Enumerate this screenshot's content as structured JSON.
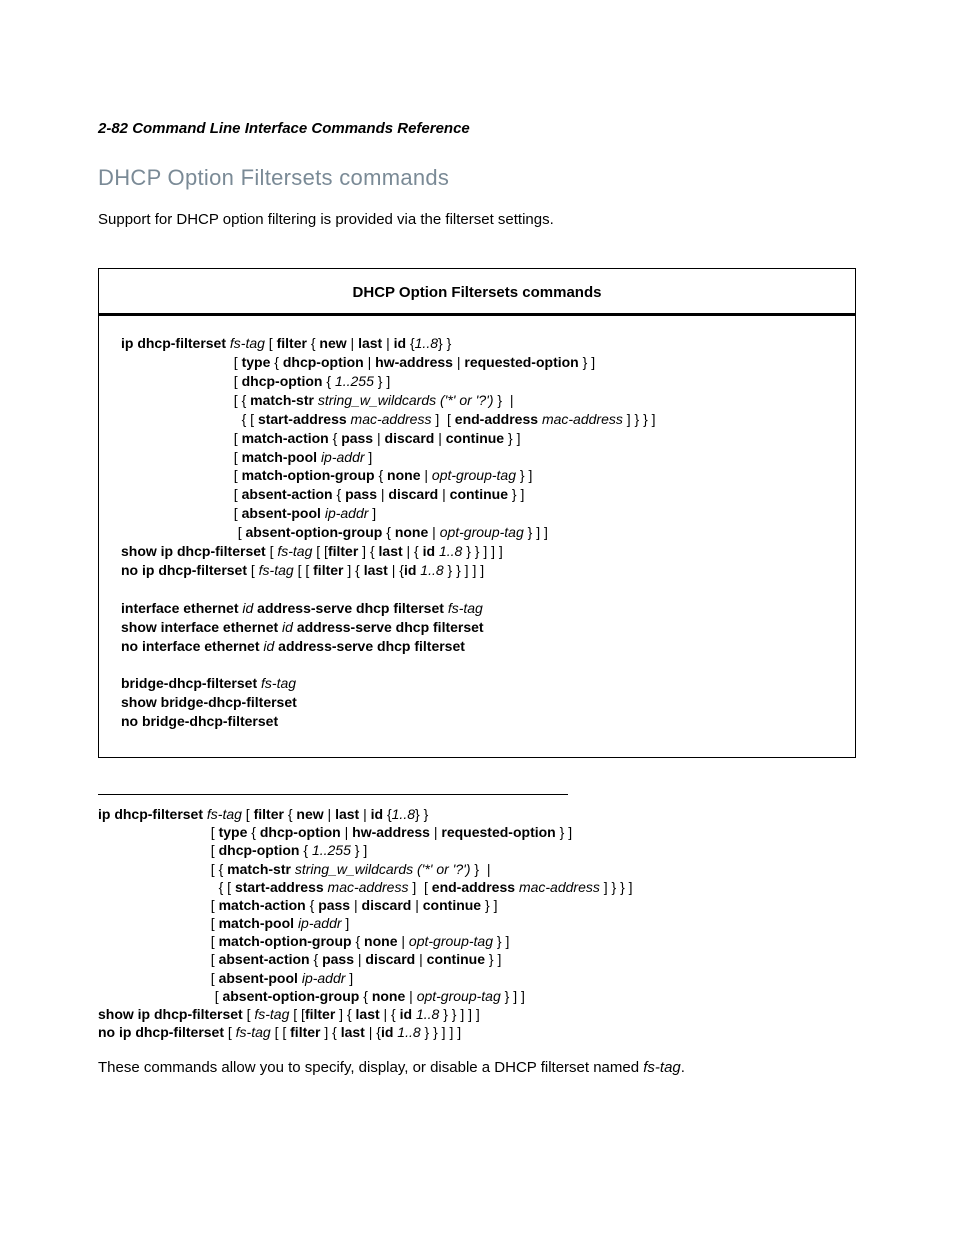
{
  "header": "2-82  Command Line Interface Commands Reference",
  "title": "DHCP Option Filtersets commands",
  "intro": "Support for DHCP option filtering is provided via the filterset settings.",
  "box_title": "DHCP Option Filtersets commands",
  "syntax_box": "<span class=\"b\">ip dhcp-filterset</span> <span class=\"i\">fs-tag</span> [ <span class=\"b\">filter</span> { <span class=\"b\">new</span> | <span class=\"b\">last</span> | <span class=\"b\">id</span> {<span class=\"i\">1..8</span>} }\n                             [ <span class=\"b\">type</span> { <span class=\"b\">dhcp-option</span> | <span class=\"b\">hw-address</span> | <span class=\"b\">requested-option</span> } ]\n                             [ <span class=\"b\">dhcp-option</span> { <span class=\"i\">1..255</span> } ]\n                             [ { <span class=\"b\">match-str</span> <span class=\"i\">string_w_wildcards ('*' or '?')</span> }  |\n                               { [ <span class=\"b\">start-address</span> <span class=\"i\">mac-address</span> ]  [ <span class=\"b\">end-address</span> <span class=\"i\">mac-address</span> ] } } ]\n                             [ <span class=\"b\">match-action</span> { <span class=\"b\">pass</span> | <span class=\"b\">discard</span> | <span class=\"b\">continue</span> } ]\n                             [ <span class=\"b\">match-pool</span> <span class=\"i\">ip-addr</span> ]\n                             [ <span class=\"b\">match-option-group</span> { <span class=\"b\">none</span> | <span class=\"i\">opt-group-tag</span> } ]\n                             [ <span class=\"b\">absent-action</span> { <span class=\"b\">pass</span> | <span class=\"b\">discard</span> | <span class=\"b\">continue</span> } ]\n                             [ <span class=\"b\">absent-pool</span> <span class=\"i\">ip-addr</span> ]\n                              [ <span class=\"b\">absent-option-group</span> { <span class=\"b\">none</span> | <span class=\"i\">opt-group-tag</span> } ] ]\n<span class=\"b\">show ip dhcp-filterset</span> [ <span class=\"i\">fs-tag</span> [ [<span class=\"b\">filter</span> ] { <span class=\"b\">last</span> | { <span class=\"b\">id</span> <span class=\"i\">1..8</span> } } ] ] ]\n<span class=\"b\">no ip dhcp-filterset</span> [ <span class=\"i\">fs-tag</span> [ [ <span class=\"b\">filter</span> ] { <span class=\"b\">last</span> | {<span class=\"b\">id</span> <span class=\"i\">1..8</span> } } ] ] ]\n\n<span class=\"b\">interface ethernet</span> <span class=\"i\">id</span> <span class=\"b\">address-serve dhcp filterset</span> <span class=\"i\">fs-tag</span>\n<span class=\"b\">show interface ethernet</span> <span class=\"i\">id</span> <span class=\"b\">address-serve dhcp filterset</span>\n<span class=\"b\">no interface ethernet</span> <span class=\"i\">id</span> <span class=\"b\">address-serve dhcp filterset</span>\n\n<span class=\"b\">bridge-dhcp-filterset</span> <span class=\"i\">fs-tag</span>\n<span class=\"b\">show bridge-dhcp-filterset</span>\n<span class=\"b\">no bridge-dhcp-filterset</span>",
  "syntax_below": "<span class=\"b\">ip dhcp-filterset</span> <span class=\"i\">fs-tag</span> [ <span class=\"b\">filter</span> { <span class=\"b\">new</span> | <span class=\"b\">last</span> | <span class=\"b\">id</span> {<span class=\"i\">1..8</span>} }\n                             [ <span class=\"b\">type</span> { <span class=\"b\">dhcp-option</span> | <span class=\"b\">hw-address</span> | <span class=\"b\">requested-option</span> } ]\n                             [ <span class=\"b\">dhcp-option</span> { <span class=\"i\">1..255</span> } ]\n                             [ { <span class=\"b\">match-str</span> <span class=\"i\">string_w_wildcards ('*' or '?')</span> }  |\n                               { [ <span class=\"b\">start-address</span> <span class=\"i\">mac-address</span> ]  [ <span class=\"b\">end-address</span> <span class=\"i\">mac-address</span> ] } } ]\n                             [ <span class=\"b\">match-action</span> { <span class=\"b\">pass</span> | <span class=\"b\">discard</span> | <span class=\"b\">continue</span> } ]\n                             [ <span class=\"b\">match-pool</span> <span class=\"i\">ip-addr</span> ]\n                             [ <span class=\"b\">match-option-group</span> { <span class=\"b\">none</span> | <span class=\"i\">opt-group-tag</span> } ]\n                             [ <span class=\"b\">absent-action</span> { <span class=\"b\">pass</span> | <span class=\"b\">discard</span> | <span class=\"b\">continue</span> } ]\n                             [ <span class=\"b\">absent-pool</span> <span class=\"i\">ip-addr</span> ]\n                              [ <span class=\"b\">absent-option-group</span> { <span class=\"b\">none</span> | <span class=\"i\">opt-group-tag</span> } ] ]\n<span class=\"b\">show ip dhcp-filterset</span> [ <span class=\"i\">fs-tag</span> [ [<span class=\"b\">filter</span> ] { <span class=\"b\">last</span> | { <span class=\"b\">id</span> <span class=\"i\">1..8</span> } } ] ] ]\n<span class=\"b\">no ip dhcp-filterset</span> [ <span class=\"i\">fs-tag</span> [ [ <span class=\"b\">filter</span> ] { <span class=\"b\">last</span> | {<span class=\"b\">id</span> <span class=\"i\">1..8</span> } } ] ] ]",
  "desc_prefix": "These commands allow you to specify, display, or disable a DHCP filterset named ",
  "desc_em": "fs-tag",
  "desc_suffix": "."
}
